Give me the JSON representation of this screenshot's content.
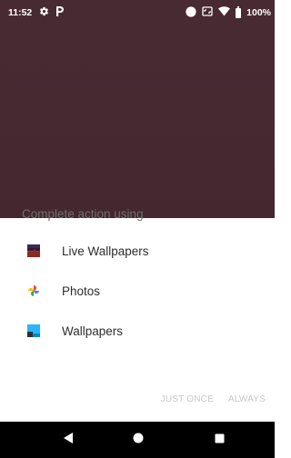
{
  "status_bar": {
    "time": "11:52",
    "battery": "100%",
    "icons": [
      "gear-icon",
      "p-icon",
      "circle-icon",
      "cast-icon",
      "wifi-icon",
      "battery-icon"
    ]
  },
  "dialog": {
    "title": "Complete action using",
    "items": [
      {
        "label": "Live Wallpapers",
        "icon": "live-wallpapers-icon"
      },
      {
        "label": "Photos",
        "icon": "photos-pinwheel-icon"
      },
      {
        "label": "Wallpapers",
        "icon": "wallpapers-icon"
      }
    ],
    "buttons": {
      "just_once": "JUST ONCE",
      "always": "ALWAYS"
    }
  },
  "nav_bar": {
    "icons": [
      "back-icon",
      "home-icon",
      "recents-icon"
    ]
  },
  "colors": {
    "scrim": "#4b2c35",
    "title_text": "#6f6f6f",
    "item_text": "#2d2d2d",
    "disabled_button": "#c8c8c8",
    "nav_bar": "#000000"
  }
}
